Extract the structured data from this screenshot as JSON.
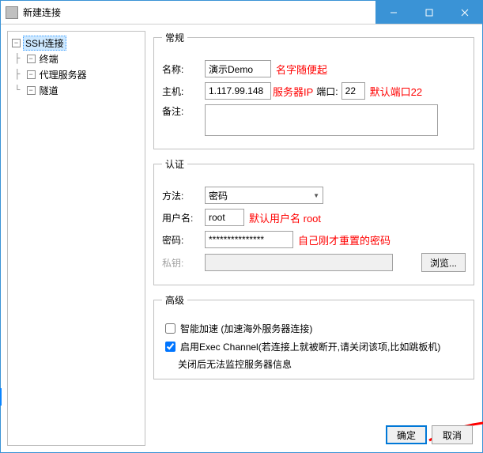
{
  "window": {
    "title": "新建连接"
  },
  "tree": {
    "root": "SSH连接",
    "children": [
      "终端",
      "代理服务器",
      "隧道"
    ]
  },
  "general": {
    "legend": "常规",
    "name_label": "名称:",
    "name_value": "演示Demo",
    "name_ann": "名字随便起",
    "host_label": "主机:",
    "host_value": "1.117.99.148",
    "host_ann": "服务器IP",
    "port_label": "端口:",
    "port_value": "22",
    "port_ann": "默认端口22",
    "remark_label": "备注:"
  },
  "auth": {
    "legend": "认证",
    "method_label": "方法:",
    "method_value": "密码",
    "user_label": "用户名:",
    "user_value": "root",
    "user_ann": "默认用户名 root",
    "pwd_label": "密码:",
    "pwd_value": "***************",
    "pwd_ann": "自己刚才重置的密码",
    "key_label": "私钥:",
    "browse": "浏览..."
  },
  "adv": {
    "legend": "高级",
    "accel": "智能加速 (加速海外服务器连接)",
    "exec": "启用Exec Channel(若连接上就被断开,请关闭该项,比如跳板机)",
    "exec_note": "关闭后无法监控服务器信息"
  },
  "buttons": {
    "ok": "确定",
    "cancel": "取消"
  }
}
